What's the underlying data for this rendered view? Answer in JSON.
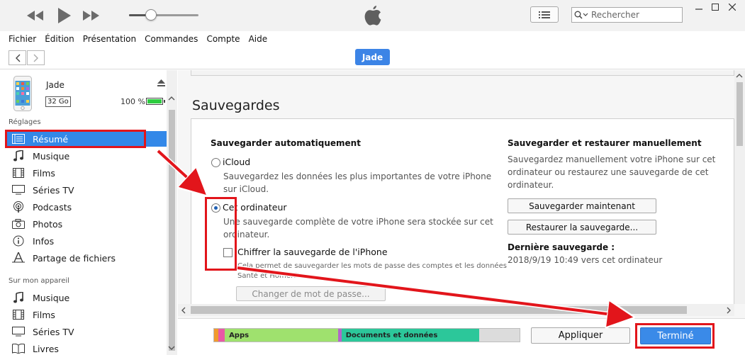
{
  "menu": [
    "Fichier",
    "Édition",
    "Présentation",
    "Commandes",
    "Compte",
    "Aide"
  ],
  "search": {
    "placeholder": "Rechercher"
  },
  "device_pill": "Jade",
  "volume_level": 0.32,
  "device": {
    "name": "Jade",
    "capacity": "32 Go",
    "battery": "100 %",
    "battery_level": 1.0
  },
  "sidebar": {
    "settings_title": "Réglages",
    "settings_items": [
      {
        "label": "Résumé",
        "icon": "summary-icon",
        "selected": true
      },
      {
        "label": "Musique",
        "icon": "music-note-icon"
      },
      {
        "label": "Films",
        "icon": "film-icon"
      },
      {
        "label": "Séries TV",
        "icon": "tv-icon"
      },
      {
        "label": "Podcasts",
        "icon": "podcast-icon"
      },
      {
        "label": "Photos",
        "icon": "camera-icon"
      },
      {
        "label": "Infos",
        "icon": "info-icon"
      },
      {
        "label": "Partage de fichiers",
        "icon": "apps-icon"
      }
    ],
    "device_title": "Sur mon appareil",
    "device_items": [
      {
        "label": "Musique",
        "icon": "music-note-icon"
      },
      {
        "label": "Films",
        "icon": "film-icon"
      },
      {
        "label": "Séries TV",
        "icon": "tv-icon"
      },
      {
        "label": "Livres",
        "icon": "book-icon"
      }
    ]
  },
  "backups": {
    "title": "Sauvegardes",
    "auto_title": "Sauvegarder automatiquement",
    "icloud_label": "iCloud",
    "icloud_desc_1": "Sauvegardez les données les plus importantes de votre iPhone",
    "icloud_desc_2": "sur iCloud.",
    "computer_label": "Cet ordinateur",
    "computer_desc_1": "Une sauvegarde complète de votre iPhone sera stockée sur cet",
    "computer_desc_2": "ordinateur.",
    "encrypt_label": "Chiffrer la sauvegarde de l'iPhone",
    "encrypt_desc_1": "Cela permet de sauvegarder les mots de passe des comptes et les données",
    "encrypt_desc_2": "Santé et HomeKit.",
    "change_password_button": "Changer de mot de passe...",
    "manual_title": "Sauvegarder et restaurer manuellement",
    "manual_desc_1": "Sauvegardez manuellement votre iPhone sur cet",
    "manual_desc_2": "ordinateur ou restaurez une sauvegarde de cet",
    "manual_desc_3": "ordinateur.",
    "backup_now_button": "Sauvegarder maintenant",
    "restore_button": "Restaurer la sauvegarde...",
    "last_backup_title": "Dernière sauvegarde :",
    "last_backup_value": "2018/9/19 10:49 vers cet ordinateur",
    "selected_option": "Cet ordinateur",
    "encrypt_checked": false
  },
  "storage": {
    "segments": [
      {
        "label": "",
        "color": "#f19a2e",
        "fraction": 0.015
      },
      {
        "label": "",
        "color": "#e85aa6",
        "fraction": 0.02
      },
      {
        "label": "Apps",
        "color": "#9fe16e",
        "fraction": 0.37
      },
      {
        "label": "",
        "color": "#b266c9",
        "fraction": 0.012
      },
      {
        "label": "Documents et données",
        "color": "#2cc79a",
        "fraction": 0.45
      },
      {
        "label": "",
        "color": "#dcdcdc",
        "fraction": 0.133
      }
    ]
  },
  "buttons": {
    "apply": "Appliquer",
    "done": "Terminé"
  },
  "colors": {
    "accent": "#3a8ae8",
    "annotation": "#e2151b",
    "selected_row": "#3388e8"
  }
}
